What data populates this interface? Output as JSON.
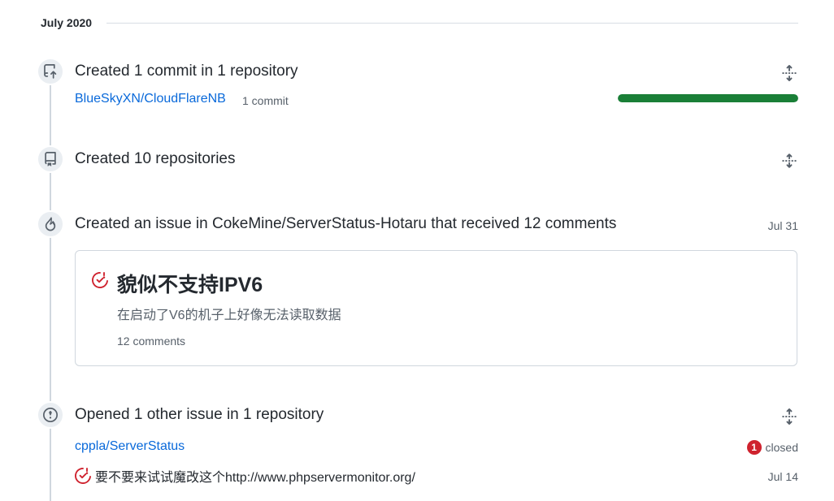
{
  "month": "July 2020",
  "events": {
    "commits": {
      "title": "Created 1 commit in 1 repository",
      "repo": "BlueSkyXN/CloudFlareNB",
      "count_label": "1 commit",
      "progress_fraction": 1.0,
      "icon": "repo-push-icon"
    },
    "repos": {
      "title": "Created 10 repositories",
      "icon": "repo-icon"
    },
    "issue_commented": {
      "title": "Created an issue in CokeMine/ServerStatus-Hotaru that received 12 comments",
      "date": "Jul 31",
      "icon": "flame-icon",
      "card": {
        "title": "貌似不支持IPV6",
        "body": "在启动了V6的机子上好像无法读取数据",
        "comments": "12 comments"
      }
    },
    "other_issues": {
      "title": "Opened 1 other issue in 1 repository",
      "repo": "cppla/ServerStatus",
      "closed_count": "1",
      "closed_label": "closed",
      "issue_title": "要不要来试试魔改这个http://www.phpservermonitor.org/",
      "date": "Jul 14",
      "icon": "issue-opened-icon"
    }
  },
  "colors": {
    "link": "#0969da",
    "progress": "#1a7f37",
    "closed": "#cf222e"
  }
}
